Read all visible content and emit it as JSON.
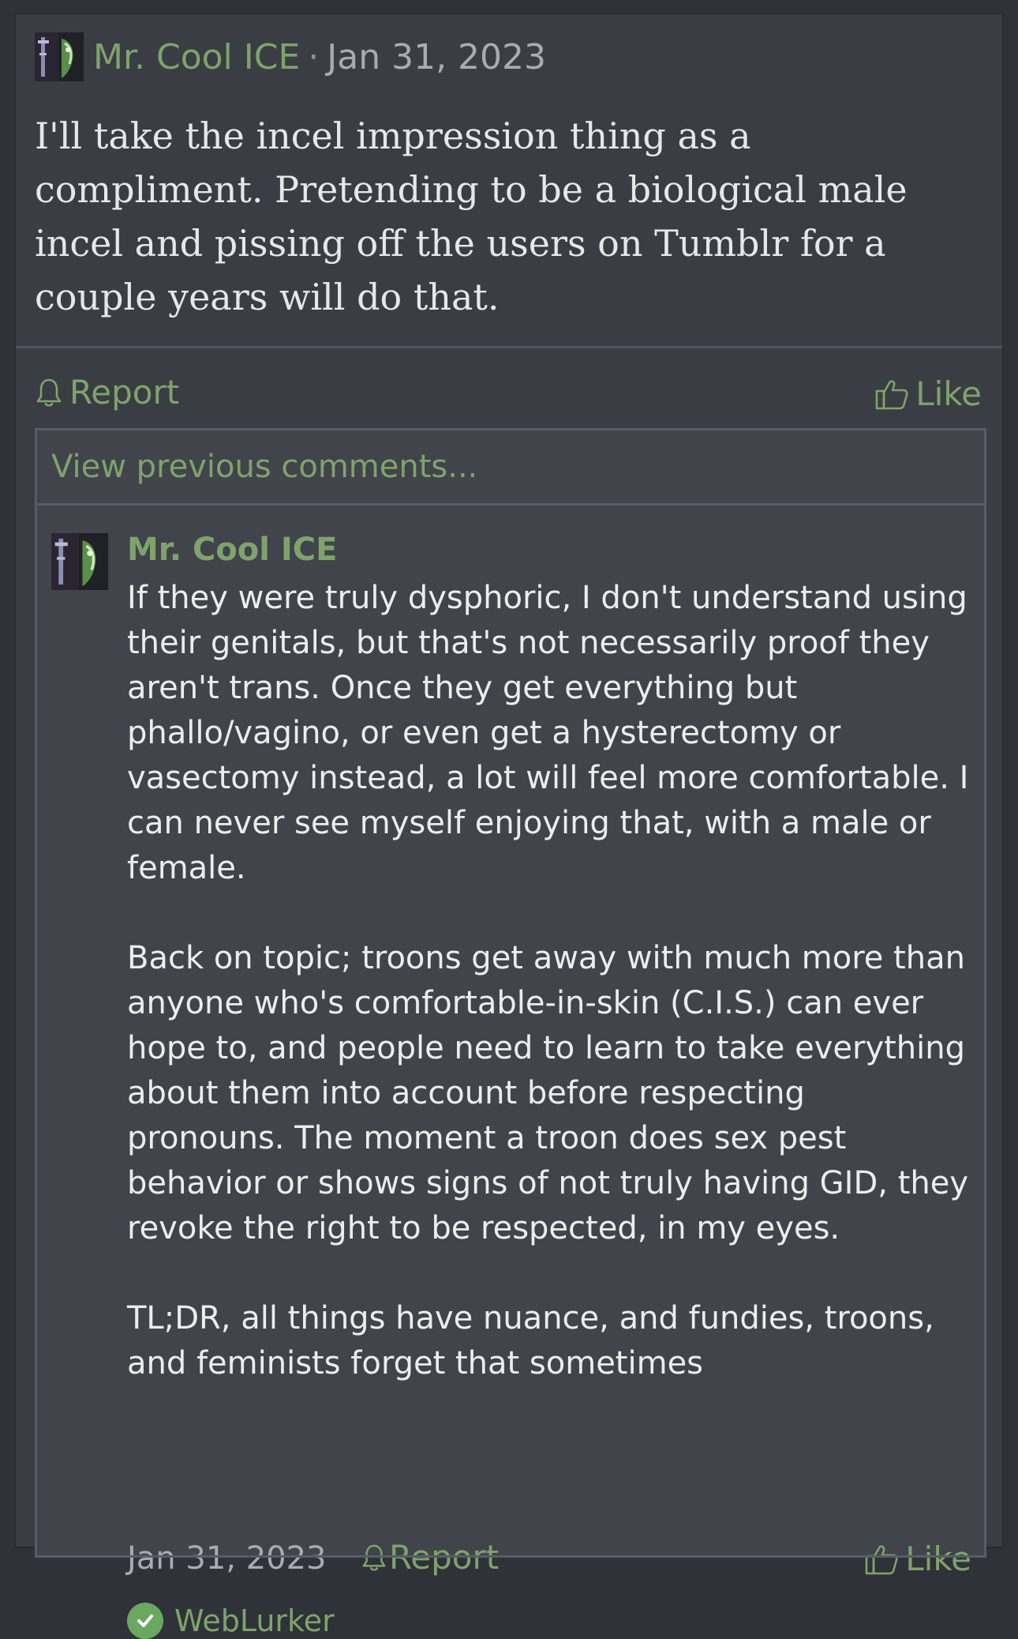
{
  "post": {
    "author": "Mr. Cool ICE",
    "separator": "·",
    "date": "Jan 31, 2023",
    "body": "I'll take the incel impression thing as a compliment. Pretending to be a biological male incel and pissing off the users on Tumblr for a couple years will do that.",
    "report_label": "Report",
    "like_label": "Like"
  },
  "comments": {
    "view_previous_label": "View previous comments...",
    "items": [
      {
        "author": "Mr. Cool ICE",
        "paragraphs": [
          "If they were truly dysphoric, I don't understand using their genitals, but that's not necessarily proof they aren't trans. Once they get everything but phallo/vagino, or even get a hysterectomy or vasectomy instead, a lot will feel more comfortable. I can never see myself enjoying that, with a male or female.",
          "Back on topic; troons get away with much more than anyone who's comfortable-in-skin (C.I.S.) can ever hope to, and people need to learn to take everything about them into account before respecting pronouns. The moment a troon does sex pest behavior or shows signs of not truly having GID, they revoke the right to be respected, in my eyes.",
          "TL;DR, all things have nuance, and fundies, troons, and feminists forget that sometimes"
        ],
        "date": "Jan 31, 2023",
        "report_label": "Report",
        "like_label": "Like",
        "liked_by": "WebLurker"
      }
    ]
  },
  "icons": {
    "report": "bell-icon",
    "like": "thumbs-up-icon",
    "verified": "check-circle-icon"
  },
  "colors": {
    "accent": "#7fa36b",
    "background": "#2f3238",
    "card": "#3a3d44",
    "text": "#e6e7e9"
  }
}
